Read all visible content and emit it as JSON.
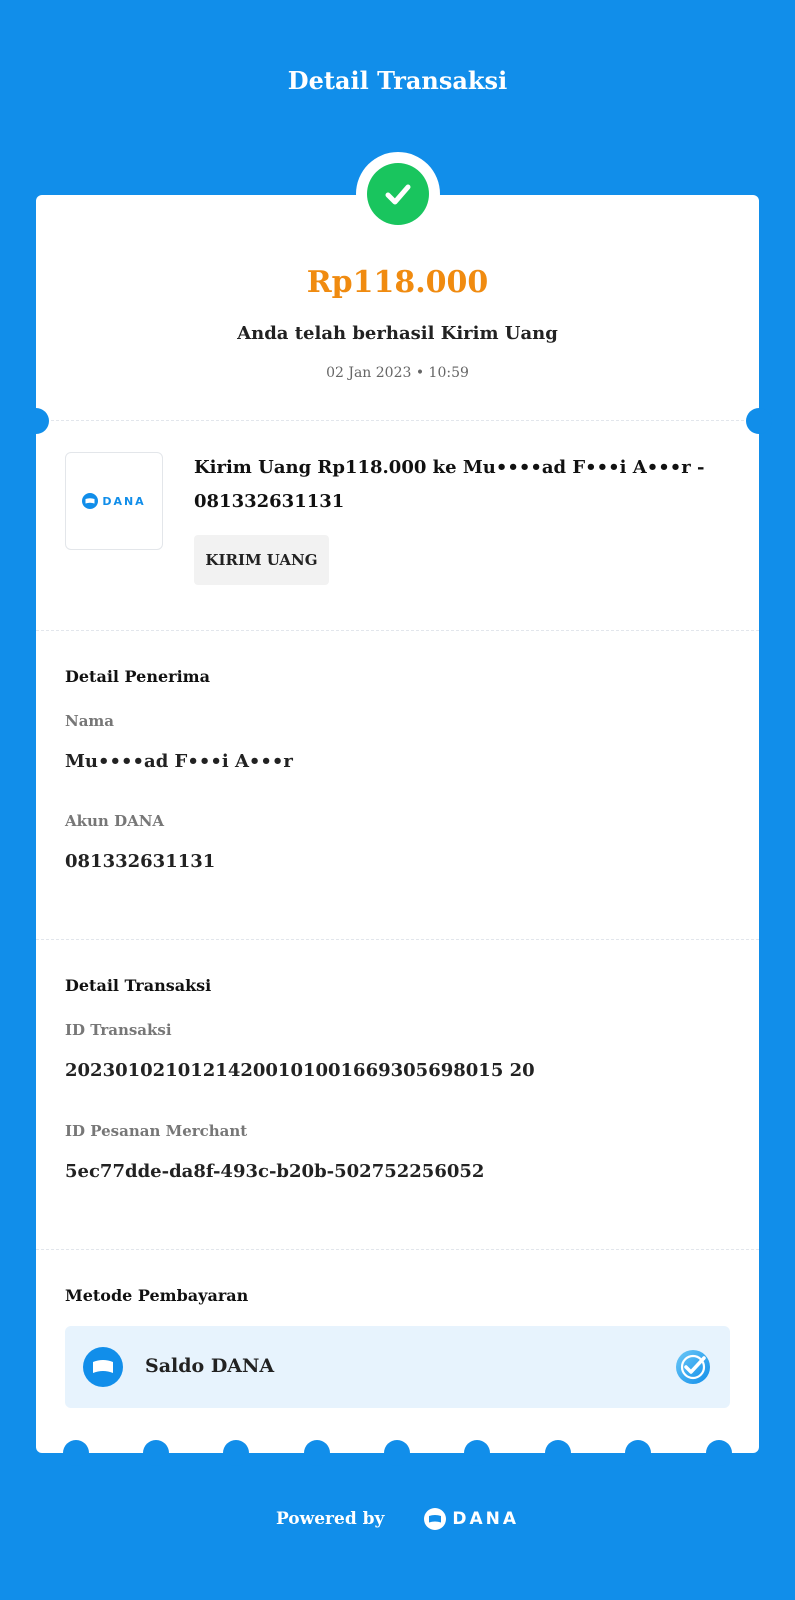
{
  "header": {
    "title": "Detail Transaksi"
  },
  "status": {
    "icon": "check-icon",
    "amount": "Rp118.000",
    "message": "Anda telah berhasil Kirim Uang",
    "datetime": "02 Jan 2023 • 10:59"
  },
  "transaction_item": {
    "merchant_logo": "DANA",
    "description": "Kirim Uang Rp118.000 ke Mu••••ad F•••i A•••r - 081332631131",
    "type_badge": "KIRIM UANG"
  },
  "recipient": {
    "title": "Detail Penerima",
    "name_label": "Nama",
    "name_value": "Mu••••ad F•••i A•••r",
    "account_label": "Akun DANA",
    "account_value": "081332631131"
  },
  "transaction": {
    "title": "Detail Transaksi",
    "id_label": "ID Transaksi",
    "id_value": "20230102101214200101001669305698015 20",
    "merchant_id_label": "ID Pesanan Merchant",
    "merchant_id_value": "5ec77dde-da8f-493c-b20b-502752256052"
  },
  "payment": {
    "title": "Metode Pembayaran",
    "method": "Saldo DANA",
    "selected": true
  },
  "footer": {
    "powered_by": "Powered by",
    "brand": "DANA"
  },
  "colors": {
    "brand_blue": "#118EEA",
    "amount_orange": "#F08B10",
    "success_green": "#19C55E",
    "payment_bg": "#E7F3FD"
  }
}
